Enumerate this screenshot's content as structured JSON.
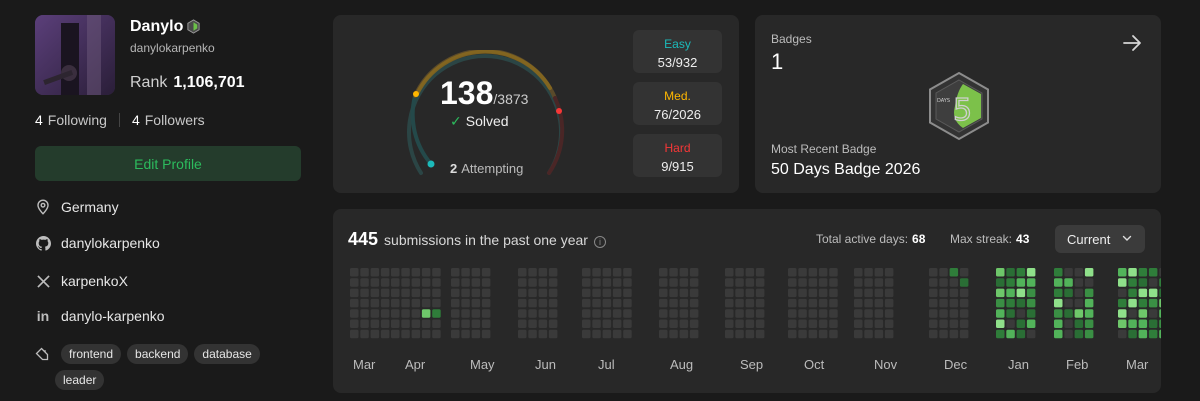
{
  "profile": {
    "name": "Danylo",
    "username": "danylokarpenko",
    "rank_label": "Rank",
    "rank_value": "1,106,701",
    "following_count": "4",
    "following_label": "Following",
    "followers_count": "4",
    "followers_label": "Followers",
    "edit_button": "Edit Profile",
    "location": "Germany",
    "github": "danylokarpenko",
    "x_handle": "karpenkoX",
    "linkedin": "danylo-karpenko",
    "skills": [
      "frontend",
      "backend",
      "database",
      "leader"
    ]
  },
  "progress": {
    "solved": "138",
    "total": "/3873",
    "solved_label": "Solved",
    "attempting_count": "2",
    "attempting_label": "Attempting",
    "difficulties": [
      {
        "label": "Easy",
        "value": "53/932",
        "color": "#1cbaba"
      },
      {
        "label": "Med.",
        "value": "76/2026",
        "color": "#ffb700"
      },
      {
        "label": "Hard",
        "value": "9/915",
        "color": "#f63737"
      }
    ]
  },
  "badges": {
    "label": "Badges",
    "count": "1",
    "recent_label": "Most Recent Badge",
    "recent_name": "50 Days Badge 2026",
    "badge_icon_text": "DAYS"
  },
  "submissions": {
    "count": "445",
    "text": "submissions in the past one year",
    "active_days_label": "Total active days:",
    "active_days": "68",
    "streak_label": "Max streak:",
    "streak": "43",
    "selector": "Current",
    "months": [
      "Mar",
      "Apr",
      "May",
      "Jun",
      "Jul",
      "Aug",
      "Sep",
      "Oct",
      "Nov",
      "Dec",
      "Jan",
      "Feb",
      "Mar"
    ]
  },
  "colors": {
    "accent_green": "#2cbb5d",
    "easy": "#1cbaba",
    "medium": "#ffb700",
    "hard": "#f63737"
  }
}
